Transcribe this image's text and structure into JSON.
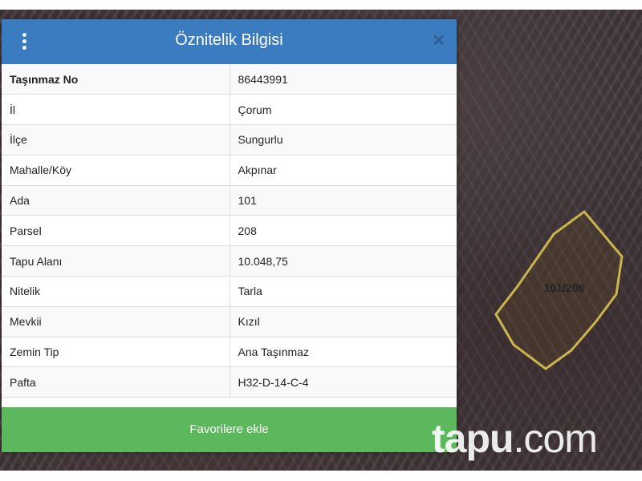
{
  "map": {
    "parcel_label": "101/208",
    "parcel_outline_color": "#c9b44a",
    "watermark_brand": "tapu",
    "watermark_suffix": ".com"
  },
  "panel": {
    "title": "Öznitelik Bilgisi",
    "menu_icon": "vertical-dots-icon",
    "close_icon": "close-icon",
    "close_symbol": "✕",
    "header_color": "#3b7bbf",
    "rows": [
      {
        "key": "Taşınmaz No",
        "value": "86443991"
      },
      {
        "key": "İl",
        "value": "Çorum"
      },
      {
        "key": "İlçe",
        "value": "Sungurlu"
      },
      {
        "key": "Mahalle/Köy",
        "value": "Akpınar"
      },
      {
        "key": "Ada",
        "value": "101"
      },
      {
        "key": "Parsel",
        "value": "208"
      },
      {
        "key": "Tapu Alanı",
        "value": "10.048,75"
      },
      {
        "key": "Nitelik",
        "value": "Tarla"
      },
      {
        "key": "Mevkii",
        "value": "Kızıl"
      },
      {
        "key": "Zemin Tip",
        "value": "Ana Taşınmaz"
      },
      {
        "key": "Pafta",
        "value": "H32-D-14-C-4"
      }
    ],
    "favorite_button": "Favorilere ekle",
    "favorite_color": "#5cb85c"
  }
}
